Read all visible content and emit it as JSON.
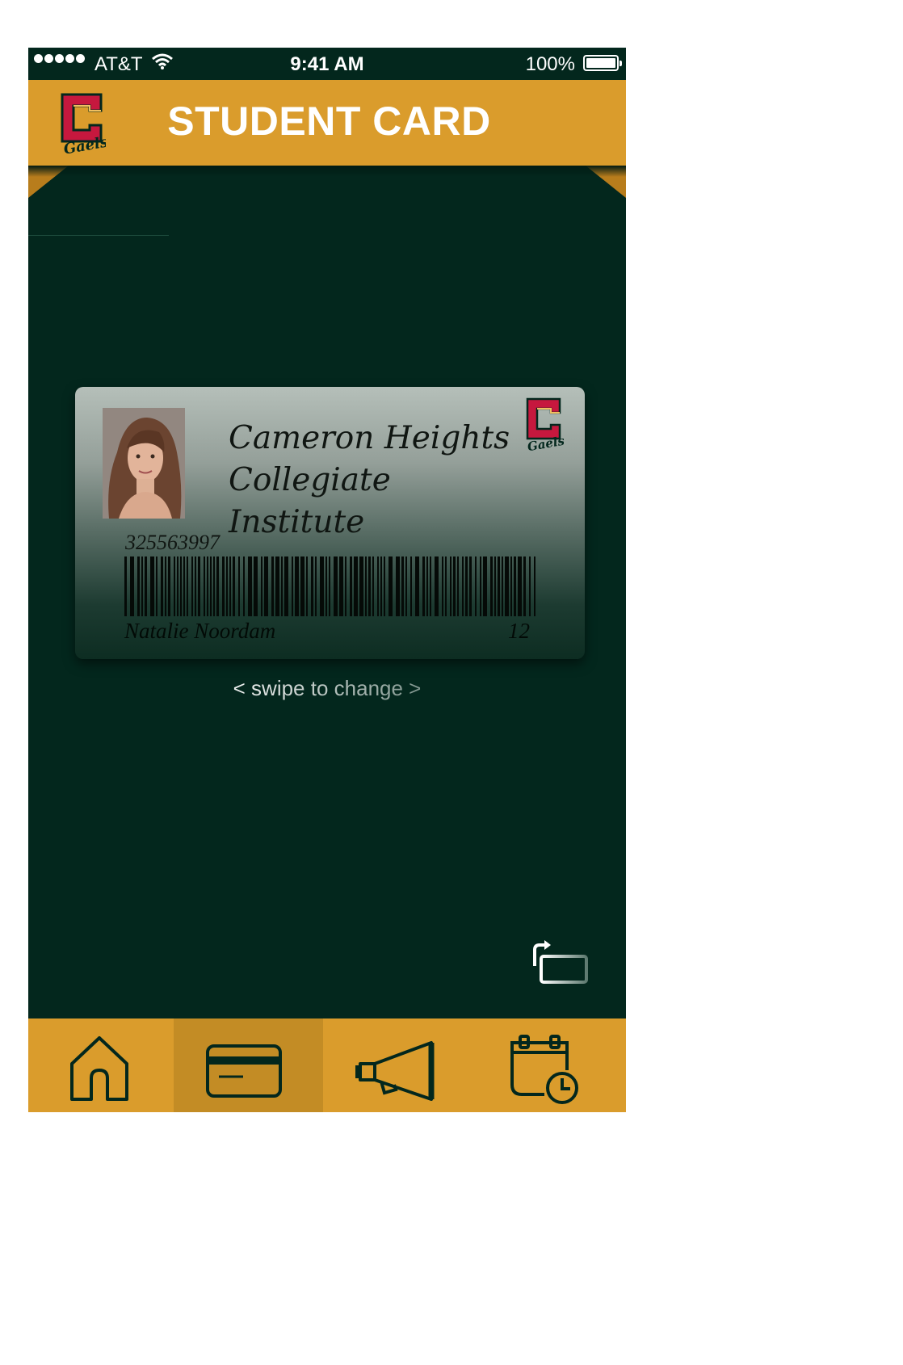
{
  "status_bar": {
    "carrier": "AT&T",
    "time": "9:41 AM",
    "battery": "100%"
  },
  "header": {
    "title": "STUDENT CARD",
    "logo_icon": "school-crest-logo"
  },
  "card": {
    "school_name_line1": "Cameron Heights",
    "school_name_line2": "Collegiate Institute",
    "student_number": "325563997",
    "student_name": "Natalie Noordam",
    "grade": "12",
    "logo_text": "Gaels"
  },
  "swipe_hint": "< swipe to change >",
  "tab_bar": {
    "tabs": [
      {
        "icon": "home-icon",
        "active": false
      },
      {
        "icon": "card-icon",
        "active": true
      },
      {
        "icon": "megaphone-icon",
        "active": false
      },
      {
        "icon": "calendar-clock-icon",
        "active": false
      }
    ]
  },
  "colors": {
    "background": "#03271d",
    "accent": "#da9c2c",
    "active_tab": "#c38c25",
    "icon": "#03271d"
  }
}
